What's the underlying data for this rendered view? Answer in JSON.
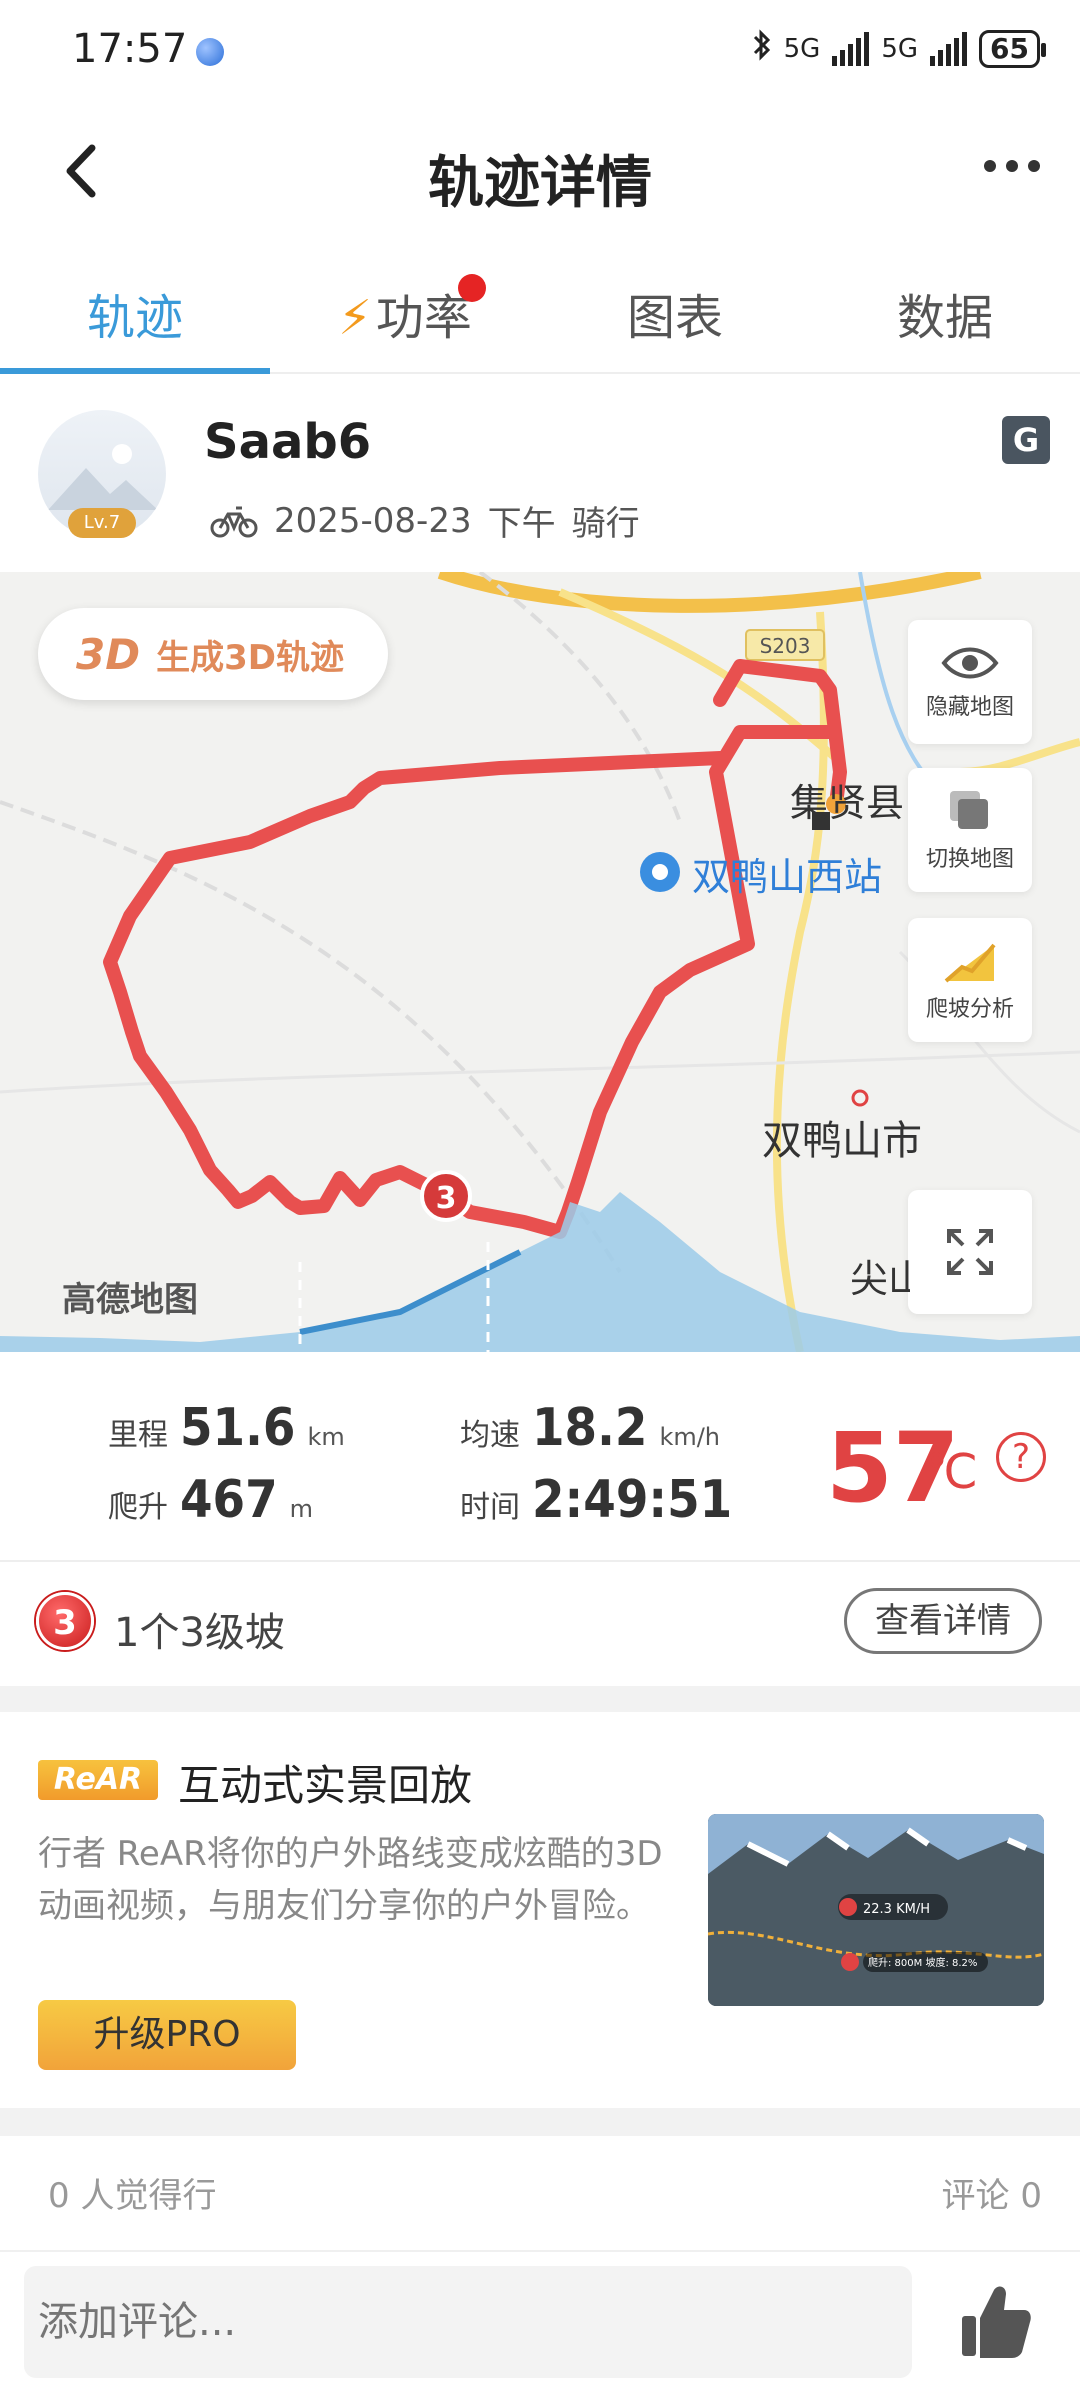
{
  "status_bar": {
    "time": "17:57",
    "battery": "65",
    "net1": "5G",
    "net2": "5G"
  },
  "header": {
    "title": "轨迹详情"
  },
  "tabs": [
    {
      "label": "轨迹",
      "active": true
    },
    {
      "label": "功率",
      "active": false,
      "has_dot": true
    },
    {
      "label": "图表",
      "active": false
    },
    {
      "label": "数据",
      "active": false
    }
  ],
  "user": {
    "name": "Saab6",
    "level": "Lv.7",
    "date": "2025-08-23",
    "time_of_day": "下午",
    "activity": "骑行"
  },
  "map": {
    "btn_3d_icon": "3D",
    "btn_3d_label": "生成3D轨迹",
    "controls": [
      {
        "label": "隐藏地图",
        "icon": "eye-icon"
      },
      {
        "label": "切换地图",
        "icon": "layers-icon"
      },
      {
        "label": "爬坡分析",
        "icon": "slope-icon"
      }
    ],
    "labels": {
      "road": "S203",
      "county": "集贤县",
      "station": "双鸭山西站",
      "city": "双鸭山市",
      "partial": "尖山区"
    },
    "climb_marker": "3",
    "provider": "高德地图"
  },
  "stats": {
    "distance_label": "里程",
    "distance_value": "51.6",
    "distance_unit": "km",
    "ascent_label": "爬升",
    "ascent_value": "467",
    "ascent_unit": "m",
    "speed_label": "均速",
    "speed_value": "18.2",
    "speed_unit": "km/h",
    "time_label": "时间",
    "time_value": "2:49:51",
    "temperature": "57",
    "temperature_unit": "℃",
    "help": "?"
  },
  "climb": {
    "badge": "3",
    "text": "1个3级坡",
    "button": "查看详情"
  },
  "rear": {
    "logo": "ReAR",
    "title": "互动式实景回放",
    "description": "行者 ReAR将你的户外路线变成炫酷的3D 动画视频，与朋友们分享你的户外冒险。",
    "upgrade": "升级PRO",
    "thumb_speed": "22.3 KM/H",
    "thumb_info": "爬升: 800M  坡度: 8.2%"
  },
  "social": {
    "likes": "0 人觉得行",
    "comments": "评论 0"
  },
  "comment": {
    "placeholder": "添加评论..."
  },
  "colors": {
    "accent": "#3a9ad9",
    "track": "#e8504f",
    "temp": "#e04343",
    "pro": "#f1a33a"
  }
}
